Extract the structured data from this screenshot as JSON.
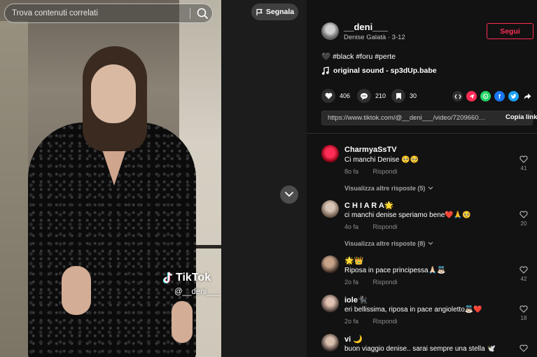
{
  "search": {
    "placeholder": "Trova contenuti correlati"
  },
  "video": {
    "report_label": "Segnala",
    "watermark_brand": "TikTok",
    "watermark_user": "@__deni___"
  },
  "author": {
    "username": "__deni___",
    "display_name": "Denise Galatà",
    "date": "3-12",
    "follow_label": "Segui"
  },
  "post": {
    "caption": "#black #foru #perte",
    "caption_emoji": "🖤",
    "sound": "original sound - sp3dUp.babe"
  },
  "stats": {
    "likes": "406",
    "comments": "210",
    "bookmarks": "30"
  },
  "share_icons": [
    "embed-icon",
    "send-icon",
    "whatsapp-icon",
    "facebook-icon",
    "twitter-icon",
    "share-arrow-icon"
  ],
  "share_colors": {
    "send": "#fe2c55",
    "whatsapp": "#25d366",
    "facebook": "#1877f2",
    "twitter": "#1da1f2"
  },
  "link": {
    "url": "https://www.tiktok.com/@__deni___/video/72096605737...",
    "copy_label": "Copia link"
  },
  "comments": [
    {
      "name": "CharmyaSsTV",
      "text": "Ci manchi Denise 🥺🥺",
      "time": "8o fa",
      "reply": "Rispondi",
      "likes": "41"
    },
    {
      "name": "C H I A R A🌟",
      "text": "ci manchi denise speriamo bene❤️🙏🥺",
      "time": "4o fa",
      "reply": "Rispondi",
      "likes": "20"
    },
    {
      "name": "🌟👑",
      "text": "Riposa in pace principessa🙏🏻👼🏻",
      "time": "2o fa",
      "reply": "Rispondi",
      "likes": "42"
    },
    {
      "name": "iole🐈‍⬛",
      "text": "eri bellissima, riposa in pace angioletto👼🏻❤️",
      "time": "2o fa",
      "reply": "Rispondi",
      "likes": "18"
    },
    {
      "name": "vi 🌙",
      "text": "buon viaggio denise.. sarai sempre una stella 🕊️",
      "time": "",
      "reply": "",
      "likes": ""
    }
  ],
  "view_more": [
    "Visualizza altre risposte (5)",
    "Visualizza altre risposte (8)"
  ],
  "accent_color": "#fe2c55"
}
